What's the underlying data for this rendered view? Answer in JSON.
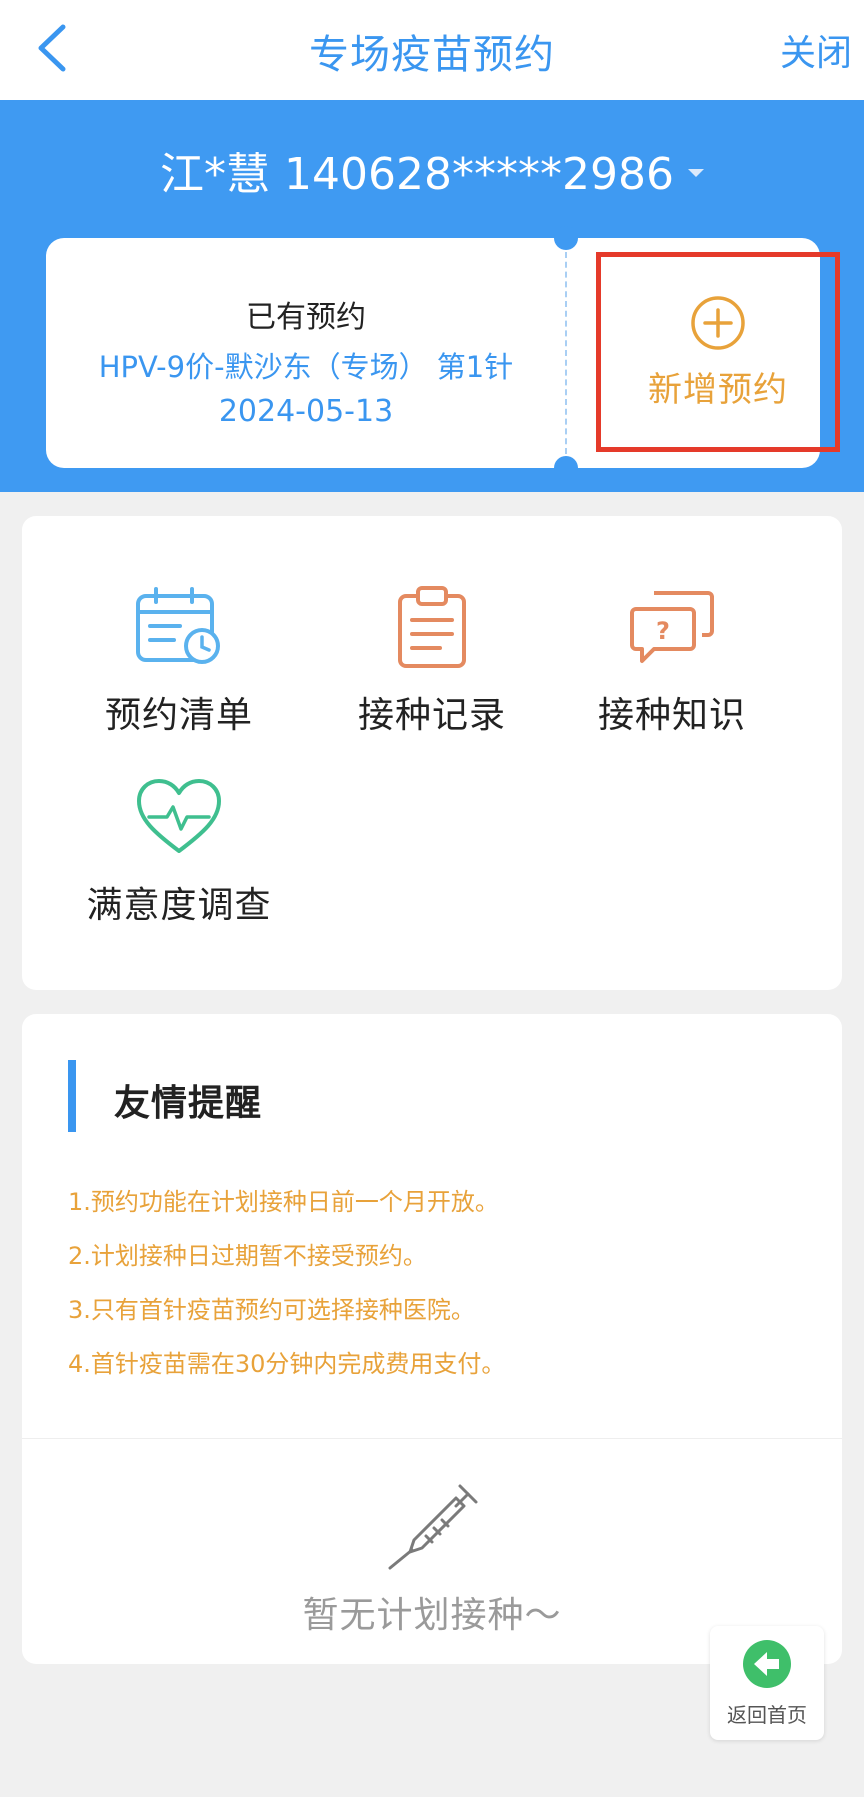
{
  "header": {
    "title": "专场疫苗预约",
    "close_label": "关闭"
  },
  "user": {
    "display": "江*慧 140628*****2986"
  },
  "ticket": {
    "existing_title": "已有预约",
    "existing_vaccine": "HPV-9价-默沙东（专场） 第1针",
    "existing_date": "2024-05-13",
    "new_label": "新增预约"
  },
  "menu": {
    "items": [
      {
        "label": "预约清单",
        "icon": "calendar-clock-icon"
      },
      {
        "label": "接种记录",
        "icon": "clipboard-icon"
      },
      {
        "label": "接种知识",
        "icon": "question-chat-icon"
      },
      {
        "label": "满意度调查",
        "icon": "heart-pulse-icon"
      }
    ]
  },
  "reminder": {
    "title": "友情提醒",
    "tips": [
      "1.预约功能在计划接种日前一个月开放。",
      "2.计划接种日过期暂不接受预约。",
      "3.只有首针疫苗预约可选择接种医院。",
      "4.首针疫苗需在30分钟内完成费用支付。"
    ],
    "empty_text": "暂无计划接种～"
  },
  "home_button": {
    "label": "返回首页"
  },
  "colors": {
    "primary_blue": "#3f9af2",
    "accent_orange": "#e8a23a",
    "highlight_red": "#e53a2a",
    "menu_blue": "#5ab2ee",
    "menu_orange": "#e48a60",
    "menu_green": "#3fbf8f"
  }
}
